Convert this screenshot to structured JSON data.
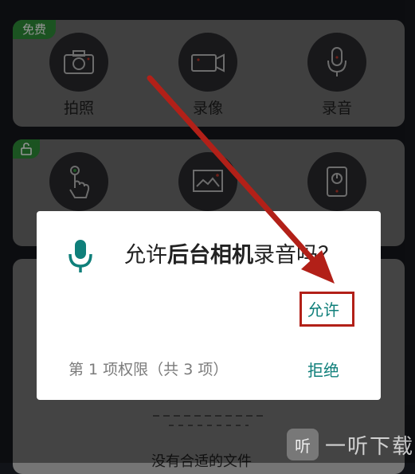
{
  "cards": {
    "free_badge": "免费",
    "row1": [
      {
        "label": "拍照",
        "icon": "camera-icon"
      },
      {
        "label": "录像",
        "icon": "video-camera-icon"
      },
      {
        "label": "录音",
        "icon": "microphone-icon"
      }
    ],
    "row2": [
      {
        "icon": "touch-icon"
      },
      {
        "icon": "image-icon"
      },
      {
        "icon": "power-icon"
      }
    ]
  },
  "dialog": {
    "title_prefix": "允许",
    "title_bold": "后台相机",
    "title_suffix": "录音吗？",
    "allow_label": "允许",
    "deny_label": "拒绝",
    "permission_count": "第 1 项权限（共 3 项）",
    "accent_color": "#0f7f7a"
  },
  "background": {
    "empty_text": "没有合适的文件"
  },
  "watermark": {
    "logo_char": "听",
    "text": "一听下载"
  },
  "annotation": {
    "arrow_color": "#b22018"
  }
}
